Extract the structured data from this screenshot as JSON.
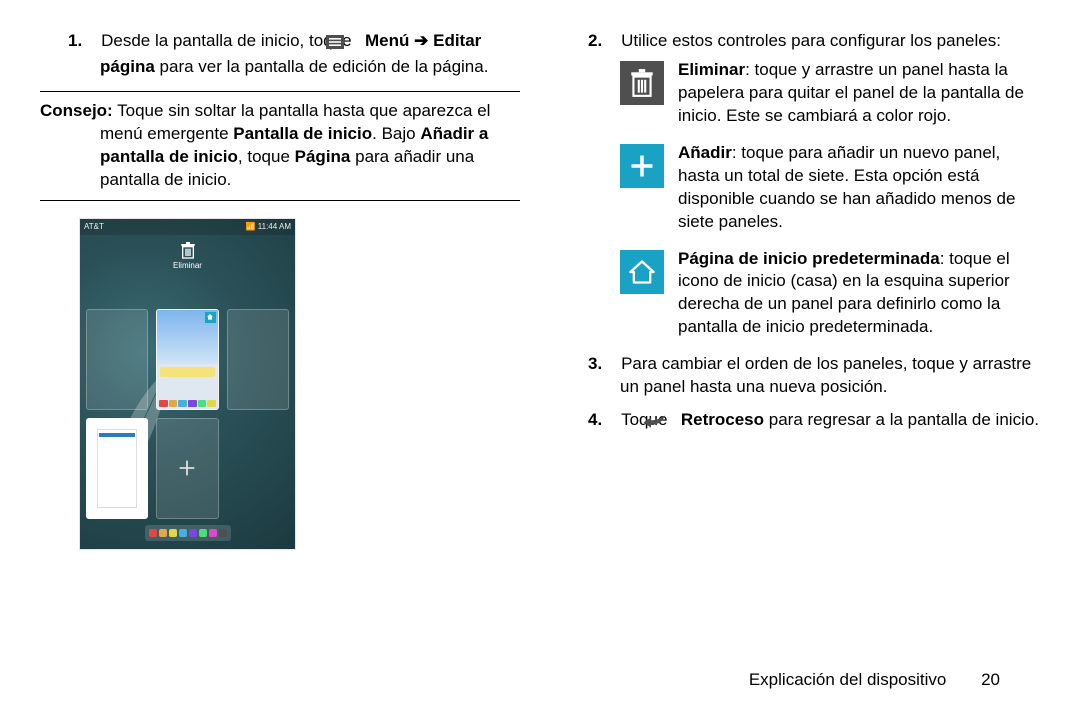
{
  "left": {
    "step1_num": "1.",
    "step1_a": "Desde la pantalla de inicio, toque ",
    "step1_menu": " Menú ",
    "step1_arrow": "➔",
    "step1_edit": " Editar página",
    "step1_b": " para ver la pantalla de edición de la página.",
    "tip_label": "Consejo:",
    "tip_a": " Toque sin soltar la pantalla hasta que aparezca el menú emergente ",
    "tip_b": "Pantalla de inicio",
    "tip_c": ". Bajo ",
    "tip_d": "Añadir a pantalla de inicio",
    "tip_e": ", toque ",
    "tip_f": "Página",
    "tip_g": " para añadir una pantalla de inicio."
  },
  "screenshot": {
    "carrier": "AT&T",
    "time": "11:44 AM",
    "delete_label": "Eliminar"
  },
  "right": {
    "step2_num": "2.",
    "step2_text": "Utilice estos controles para configurar los paneles:",
    "trash_label": "Eliminar",
    "trash_text": ": toque y arrastre un panel hasta la papelera para quitar el panel de la pantalla de inicio. Este se cambiará a color rojo.",
    "plus_label": "Añadir",
    "plus_text": ": toque para añadir un nuevo panel, hasta un total de siete. Esta opción está disponible cuando se han añadido menos de siete paneles.",
    "home_label": "Página de inicio predeterminada",
    "home_text": ": toque el icono de inicio (casa) en la esquina superior derecha de un panel para definirlo como la pantalla de inicio predeterminada.",
    "step3_num": "3.",
    "step3_text": "Para cambiar el orden de los paneles, toque y arrastre un panel hasta una nueva posición.",
    "step4_num": "4.",
    "step4_a": "Toque ",
    "step4_back": " Retroceso",
    "step4_b": " para regresar a la pantalla de inicio."
  },
  "footer": {
    "section": "Explicación del dispositivo",
    "page": "20"
  },
  "icon_colors": {
    "dock": [
      "#e04848",
      "#e0a848",
      "#e0d848",
      "#48b0e0",
      "#7a48e0",
      "#48e07a",
      "#e048d0",
      "#4f4f50"
    ],
    "main_icons": [
      "#e04848",
      "#e0a848",
      "#48b0e0",
      "#7a48e0",
      "#48e07a",
      "#e0d848"
    ]
  }
}
